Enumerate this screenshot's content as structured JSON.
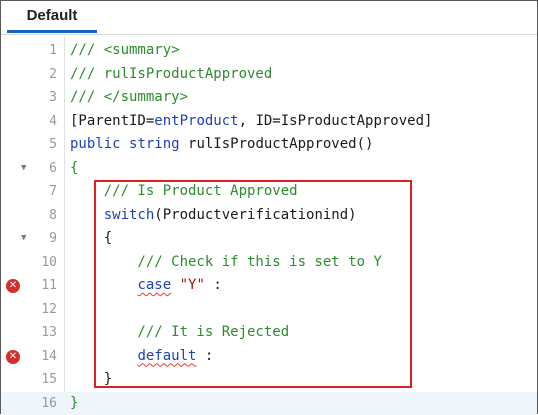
{
  "tab": {
    "label": "Default"
  },
  "lines": [
    {
      "n": "1",
      "tokens": [
        {
          "t": "/// <summary>",
          "c": "c-comment"
        }
      ]
    },
    {
      "n": "2",
      "tokens": [
        {
          "t": "/// rulIsProductApproved",
          "c": "c-comment"
        }
      ]
    },
    {
      "n": "3",
      "tokens": [
        {
          "t": "/// </summary>",
          "c": "c-comment"
        }
      ]
    },
    {
      "n": "4",
      "tokens": [
        {
          "t": "[ParentID=",
          "c": "c-plain"
        },
        {
          "t": "entProduct",
          "c": "c-kw"
        },
        {
          "t": ", ID=IsProductApproved]",
          "c": "c-plain"
        }
      ]
    },
    {
      "n": "5",
      "tokens": [
        {
          "t": "public",
          "c": "c-kw"
        },
        {
          "t": " ",
          "c": "c-plain"
        },
        {
          "t": "string",
          "c": "c-kw"
        },
        {
          "t": " rulIsProductApproved()",
          "c": "c-plain"
        }
      ]
    },
    {
      "n": "6",
      "fold": true,
      "tokens": [
        {
          "t": "{",
          "c": "c-comment"
        }
      ]
    },
    {
      "n": "7",
      "tokens": [
        {
          "t": "    /// Is Product Approved",
          "c": "c-comment"
        }
      ]
    },
    {
      "n": "8",
      "tokens": [
        {
          "t": "    ",
          "c": "c-plain"
        },
        {
          "t": "switch",
          "c": "c-kw"
        },
        {
          "t": "(Productverificationind)",
          "c": "c-plain"
        }
      ]
    },
    {
      "n": "9",
      "fold": true,
      "tokens": [
        {
          "t": "    {",
          "c": "c-plain"
        }
      ]
    },
    {
      "n": "10",
      "tokens": [
        {
          "t": "        /// Check if this is set to Y",
          "c": "c-comment"
        }
      ]
    },
    {
      "n": "11",
      "error": true,
      "tokens": [
        {
          "t": "        ",
          "c": "c-plain"
        },
        {
          "t": "case",
          "c": "c-kw",
          "squiggle": true
        },
        {
          "t": " ",
          "c": "c-plain"
        },
        {
          "t": "\"Y\"",
          "c": "c-str"
        },
        {
          "t": " :",
          "c": "c-plain"
        }
      ]
    },
    {
      "n": "12",
      "tokens": []
    },
    {
      "n": "13",
      "tokens": [
        {
          "t": "        /// It is Rejected",
          "c": "c-comment"
        }
      ]
    },
    {
      "n": "14",
      "error": true,
      "tokens": [
        {
          "t": "        ",
          "c": "c-plain"
        },
        {
          "t": "default",
          "c": "c-kw",
          "squiggle": true
        },
        {
          "t": " :",
          "c": "c-plain"
        }
      ]
    },
    {
      "n": "15",
      "tokens": [
        {
          "t": "    }",
          "c": "c-plain"
        }
      ]
    },
    {
      "n": "16",
      "active": true,
      "tokens": [
        {
          "t": "}",
          "c": "c-comment"
        }
      ]
    }
  ],
  "icons": {
    "fold": "fold-arrow-icon",
    "error": "error-x-icon"
  }
}
